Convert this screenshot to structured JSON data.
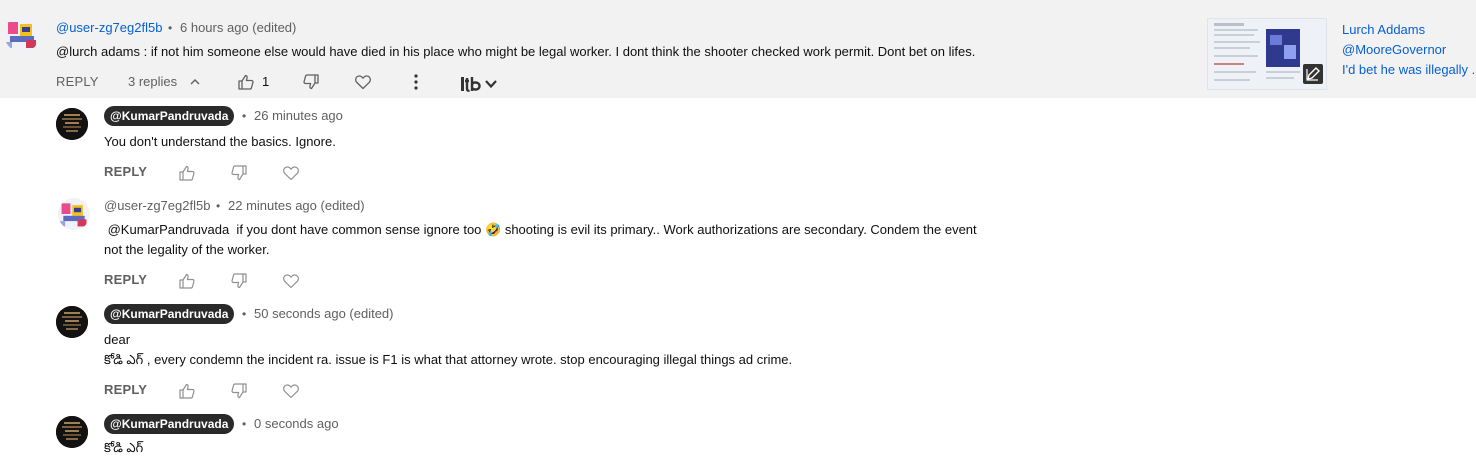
{
  "top_comment": {
    "author": "@user-zg7eg2fl5b",
    "time": "6 hours ago (edited)",
    "text": "@lurch adams : if not him someone else would have died in his place who might be legal worker. I dont think the shooter checked work permit. Dont bet on lifes.",
    "reply_label": "REPLY",
    "replies_count_label": "3 replies",
    "like_count": "1",
    "icons": [
      "thumbs-up-icon",
      "thumbs-down-icon",
      "heart-icon",
      "more-vert-icon",
      "tubebuddy-icon",
      "chevron-down-icon",
      "chevron-up-icon"
    ]
  },
  "side_panel": {
    "name": "Lurch Addams",
    "mention": "@MooreGovernor",
    "snippet": "I'd bet he was illegally ..",
    "icons": [
      "screenshot-thumbnail",
      "edit-icon"
    ]
  },
  "replies": [
    {
      "author": "@KumarPandruvada",
      "time": "26 minutes ago",
      "lines": [
        "You don't understand the basics. Ignore."
      ],
      "reply_label": "REPLY"
    },
    {
      "author": "@user-zg7eg2fl5b",
      "time": "22 minutes ago (edited)",
      "lines": [
        " @KumarPandruvada  if you dont have common sense ignore too 🤣 shooting is evil its primary.. Work authorizations are secondary. Condem the event",
        "not the legality of the worker."
      ],
      "reply_label": "REPLY"
    },
    {
      "author": "@KumarPandruvada",
      "time": "50 seconds ago (edited)",
      "lines": [
        "dear",
        "కోడి ఎగ్ , every condemn the incident ra. issue is F1 is what that attorney wrote. stop encouraging illegal things ad crime."
      ],
      "reply_label": "REPLY"
    },
    {
      "author": "@KumarPandruvada",
      "time": "0 seconds ago",
      "lines": [
        "కోడి ఎగ్"
      ]
    }
  ],
  "colors": {
    "link": "#065fd4",
    "muted": "#606060",
    "chip_bg": "#2a2a2a",
    "highlight_bg": "#f2f2f2"
  }
}
